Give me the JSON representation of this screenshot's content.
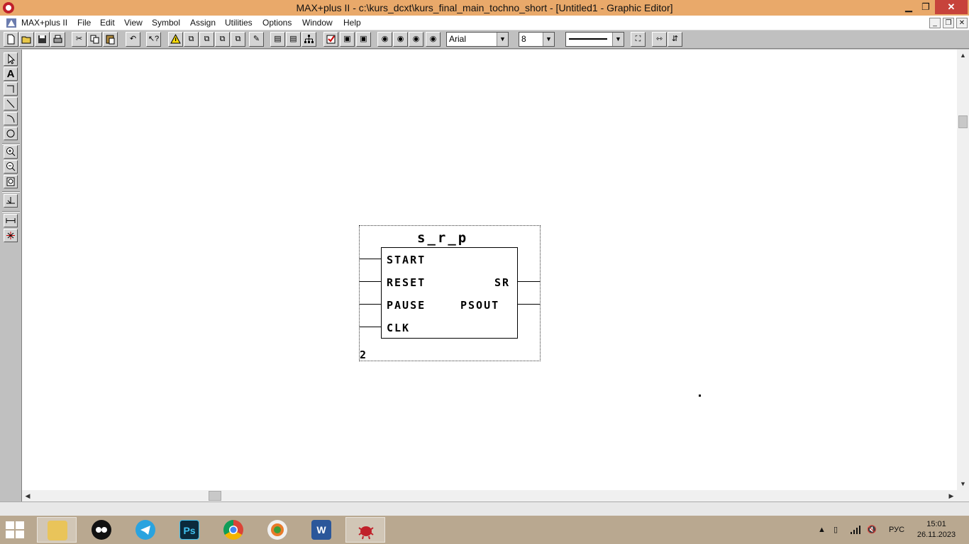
{
  "window": {
    "title": "MAX+plus II - c:\\kurs_dcxt\\kurs_final_main_tochno_short - [Untitled1 - Graphic Editor]",
    "min_glyph": "▁",
    "max_glyph": "❐",
    "close_glyph": "✕"
  },
  "menubar": {
    "app_label": "MAX+plus II",
    "items": [
      "File",
      "Edit",
      "View",
      "Symbol",
      "Assign",
      "Utilities",
      "Options",
      "Window",
      "Help"
    ],
    "mdi_min": "_",
    "mdi_restore": "❐",
    "mdi_close": "✕"
  },
  "toolbar": {
    "font_name": "Arial",
    "font_size": "8",
    "dropdown_glyph": "▼"
  },
  "symbol": {
    "name": "s_r_p",
    "inputs": [
      "START",
      "RESET",
      "PAUSE",
      "CLK"
    ],
    "outputs": [
      "SR",
      "PSOUT"
    ],
    "instance_number": "2"
  },
  "scroll": {
    "up": "▲",
    "down": "▼",
    "left": "◀",
    "right": "▶"
  },
  "taskbar": {
    "language": "РУС",
    "time": "15:01",
    "date": "26.11.2023",
    "word_label": "W",
    "ps_label": "Ps"
  }
}
